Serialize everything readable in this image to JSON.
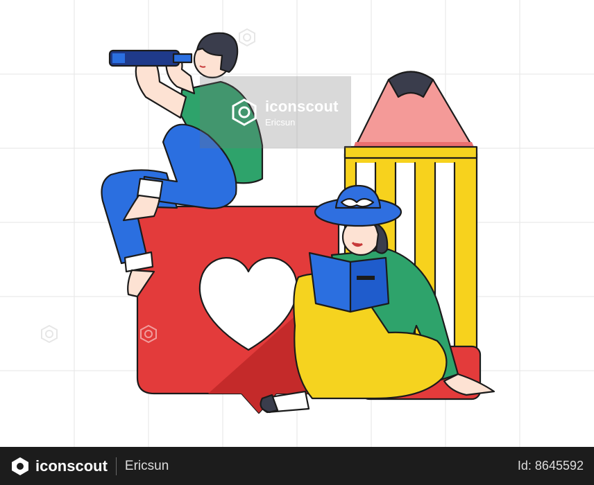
{
  "watermark": {
    "brand": "iconscout",
    "author": "Ericsun"
  },
  "footer": {
    "brand": "iconscout",
    "author": "Ericsun",
    "asset_id": "Id: 8645592"
  },
  "illustration": {
    "subject": "Man with telescope sitting on a like badge, woman reading a book beside a pencil",
    "colors": {
      "badge_red": "#e33b3b",
      "badge_shadow": "#b82626",
      "shirt_green": "#2ea36b",
      "pants_blue": "#2b6fe0",
      "pants_yellow": "#f5d31f",
      "pencil_yellow": "#f7d21d",
      "pencil_tip": "#f28b8b",
      "skin": "#fde2d3",
      "hair": "#3a3d4c",
      "hat_blue": "#2f6fe0"
    }
  }
}
